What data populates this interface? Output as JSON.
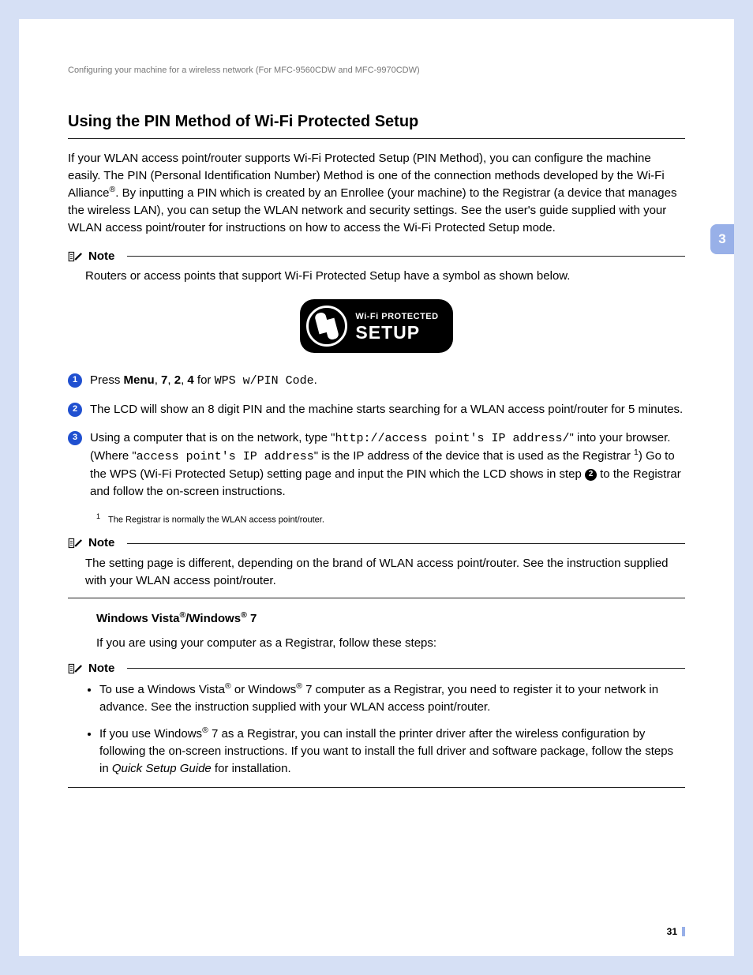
{
  "breadcrumb": "Configuring your machine for a wireless network (For MFC-9560CDW and MFC-9970CDW)",
  "section_title": "Using the PIN Method of Wi-Fi Protected Setup",
  "intro_a": "If your WLAN access point/router supports Wi-Fi Protected Setup (PIN Method), you can configure the machine easily. The PIN (Personal Identification Number) Method is one of the connection methods developed by the Wi-Fi Alliance",
  "intro_b": ". By inputting a PIN which is created by an Enrollee (your machine) to the Registrar (a device that manages the wireless LAN), you can setup the WLAN network and security settings. See the user's guide supplied with your WLAN access point/router for instructions on how to access the Wi-Fi Protected Setup mode.",
  "reg_mark": "®",
  "note_label": "Note",
  "note1_body": "Routers or access points that support Wi-Fi Protected Setup have a symbol as shown below.",
  "wps_line1": "Wi-Fi PROTECTED",
  "wps_line2": "SETUP",
  "step1_a": "Press ",
  "step1_menu": "Menu",
  "step1_b": ", ",
  "step1_7": "7",
  "step1_c": ", ",
  "step1_2": "2",
  "step1_d": ", ",
  "step1_4": "4",
  "step1_e": " for ",
  "step1_code": "WPS w/PIN Code",
  "step1_f": ".",
  "step2": "The LCD will show an 8 digit PIN and the machine starts searching for a WLAN access point/router for 5 minutes.",
  "step3_a": "Using a computer that is on the network, type \"",
  "step3_code1": "http://access point's IP address/",
  "step3_b": "\" into your browser. (Where \"",
  "step3_code2": "access point's IP address",
  "step3_c": "\" is the IP address of the device that is used as the Registrar ",
  "step3_fn": "1",
  "step3_d": ") Go to the WPS (Wi-Fi Protected Setup) setting page and input the PIN which the LCD shows in step ",
  "step3_ref": "2",
  "step3_e": " to the Registrar and follow the on-screen instructions.",
  "footnote1_num": "1",
  "footnote1_text": "The Registrar is normally the WLAN access point/router.",
  "note2_body": "The setting page is different, depending on the brand of WLAN access point/router. See the instruction supplied with your WLAN access point/router.",
  "subhead_a": "Windows Vista",
  "subhead_b": "/Windows",
  "subhead_c": " 7",
  "sub_body": "If you are using your computer as a Registrar, follow these steps:",
  "note3_li1_a": "To use a Windows Vista",
  "note3_li1_b": " or Windows",
  "note3_li1_c": " 7 computer as a Registrar, you need to register it to your network in advance. See the instruction supplied with your WLAN access point/router.",
  "note3_li2_a": "If you use Windows",
  "note3_li2_b": " 7 as a Registrar, you can install the printer driver after the wireless configuration by following the on-screen instructions. If you want to install the full driver and software package, follow the steps in ",
  "note3_li2_guide": "Quick Setup Guide",
  "note3_li2_c": " for installation.",
  "side_tab": "3",
  "page_num": "31"
}
